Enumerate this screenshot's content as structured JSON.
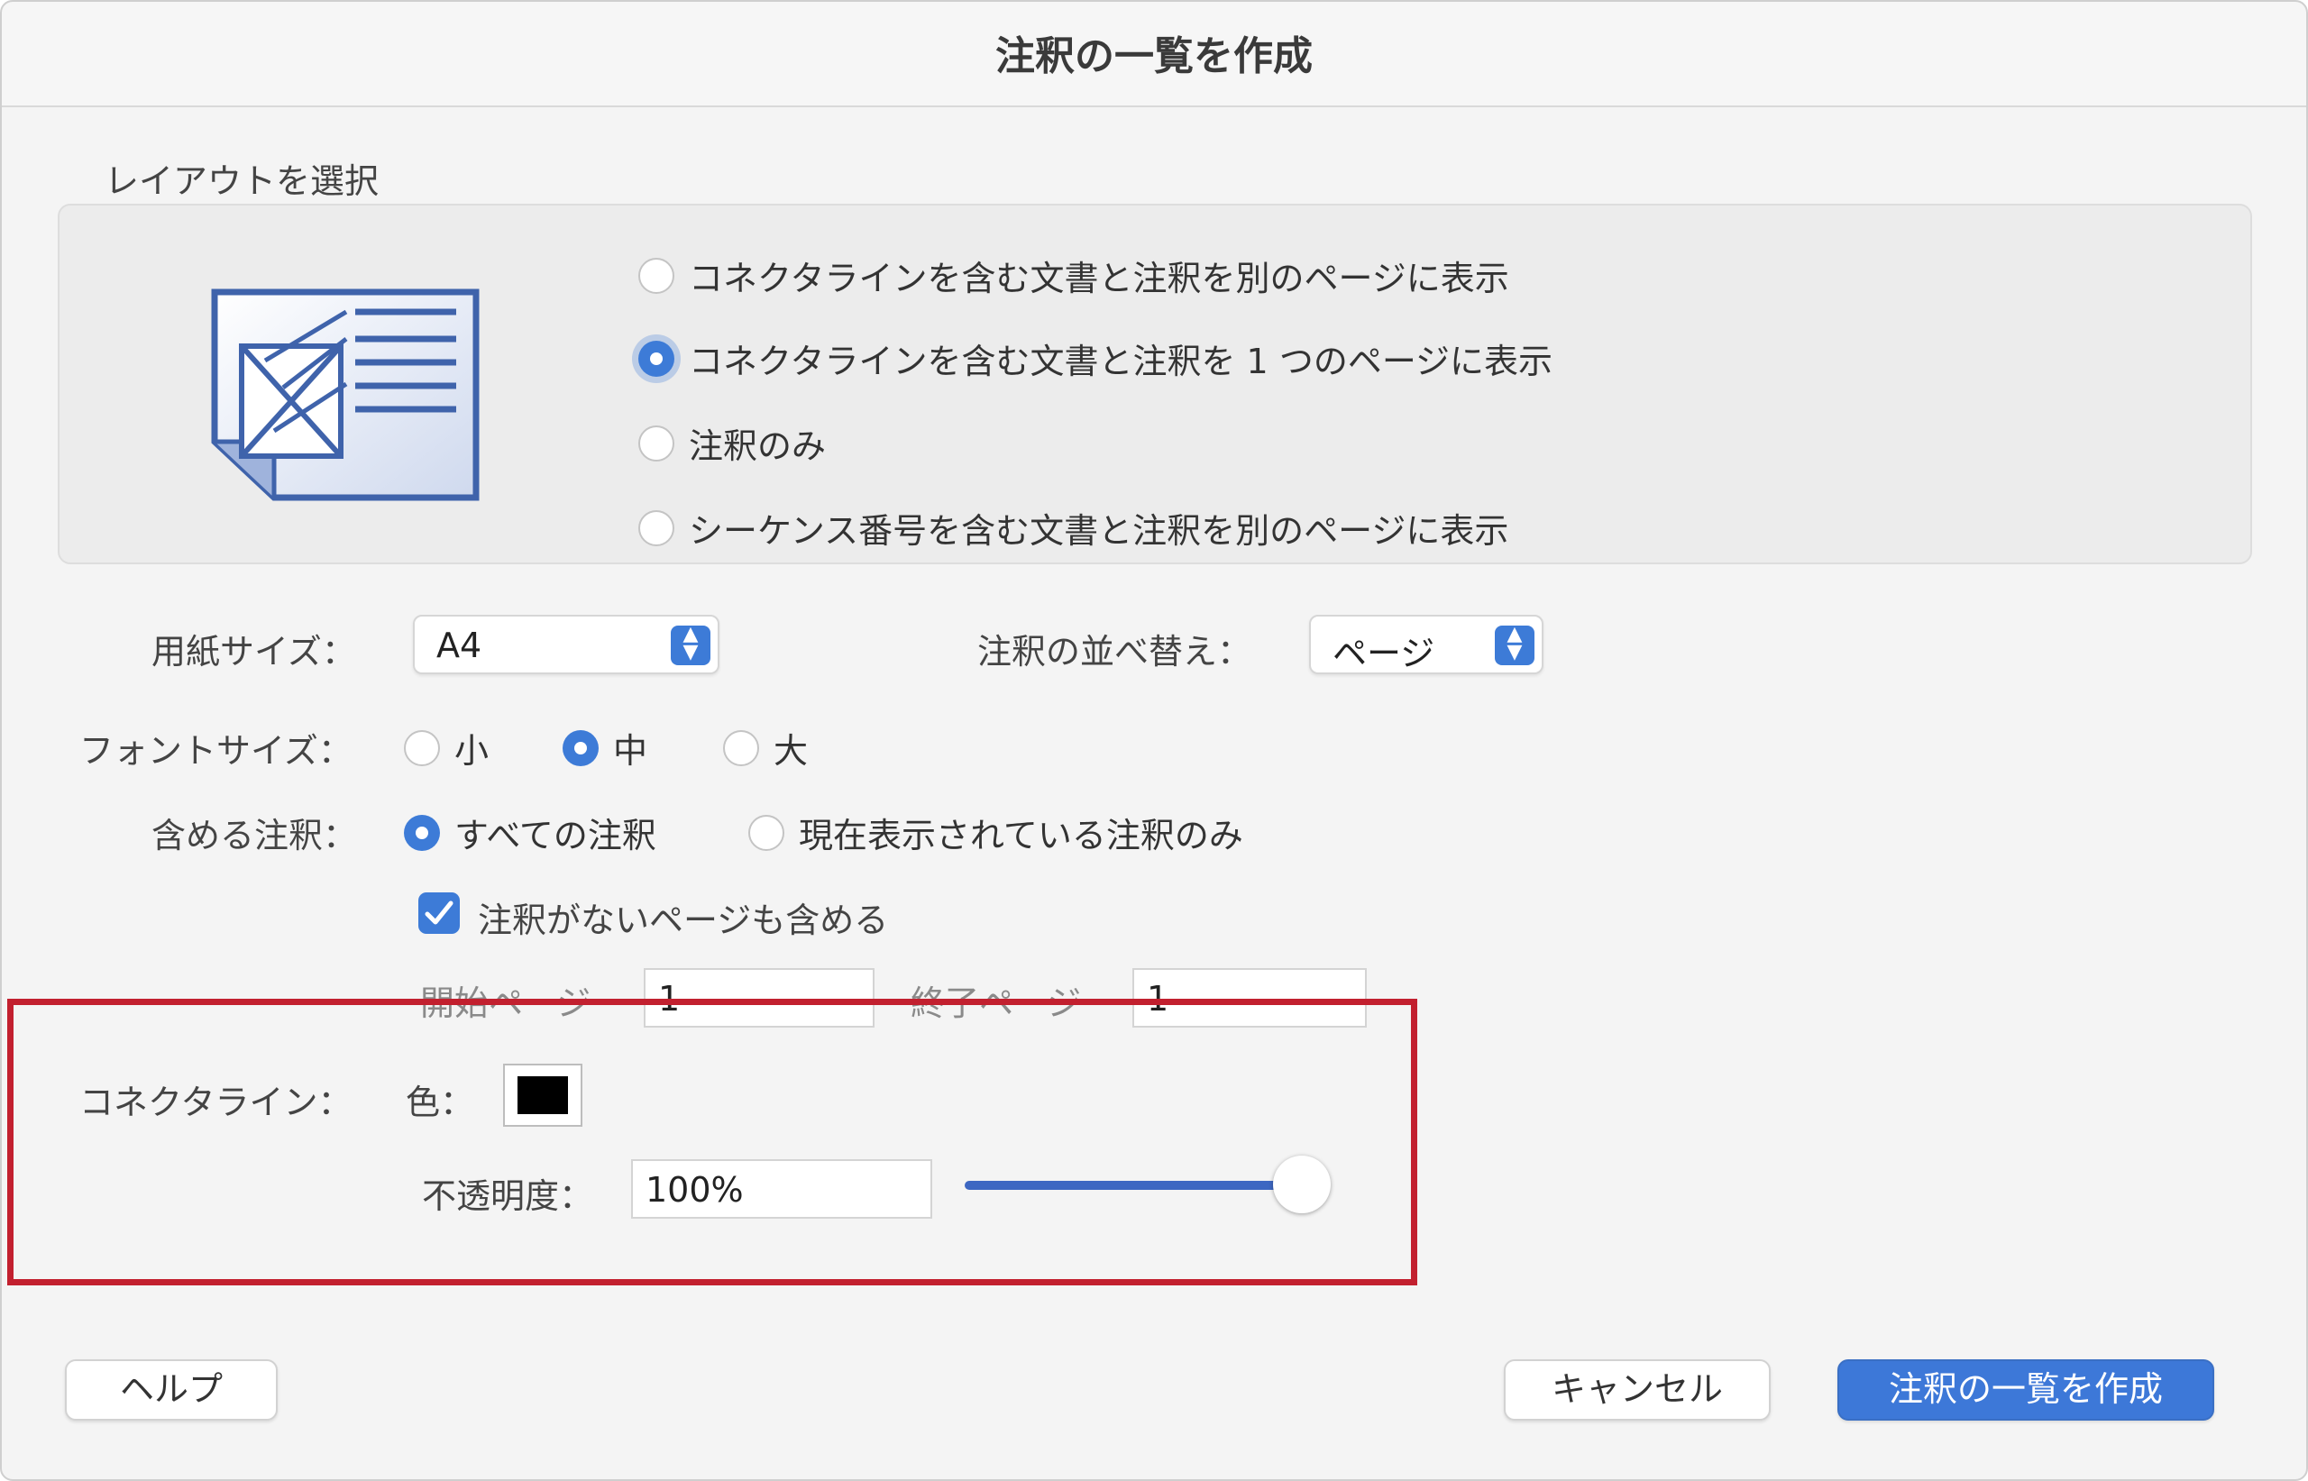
{
  "dialog": {
    "title": "注釈の一覧を作成"
  },
  "layout": {
    "label": "レイアウトを選択",
    "options": [
      {
        "label": "コネクタラインを含む文書と注釈を別のページに表示",
        "selected": false
      },
      {
        "label": "コネクタラインを含む文書と注釈を 1 つのページに表示",
        "selected": true
      },
      {
        "label": "注釈のみ",
        "selected": false
      },
      {
        "label": "シーケンス番号を含む文書と注釈を別のページに表示",
        "selected": false
      }
    ]
  },
  "paper": {
    "label": "用紙サイズ：",
    "value": "A4"
  },
  "sort": {
    "label": "注釈の並べ替え：",
    "value": "ページ"
  },
  "font_size": {
    "label": "フォントサイズ：",
    "options": [
      {
        "label": "小",
        "selected": false
      },
      {
        "label": "中",
        "selected": true
      },
      {
        "label": "大",
        "selected": false
      }
    ]
  },
  "include": {
    "label": "含める注釈：",
    "options": [
      {
        "label": "すべての注釈",
        "selected": true
      },
      {
        "label": "現在表示されている注釈のみ",
        "selected": false
      }
    ],
    "empty_pages_label": "注釈がないページも含める",
    "empty_pages_checked": true
  },
  "range": {
    "start_label": "開始ページ",
    "start_value": "1",
    "end_label": "終了ページ",
    "end_value": "1"
  },
  "connector": {
    "label": "コネクタライン：",
    "color_label": "色：",
    "color": "#000000",
    "opacity_label": "不透明度：",
    "opacity_value": "100%",
    "opacity_level": 1.0
  },
  "buttons": {
    "help": "ヘルプ",
    "cancel": "キャンセル",
    "create": "注釈の一覧を作成"
  },
  "colors": {
    "accent": "#3d7bd7",
    "highlight": "#c2202f"
  }
}
